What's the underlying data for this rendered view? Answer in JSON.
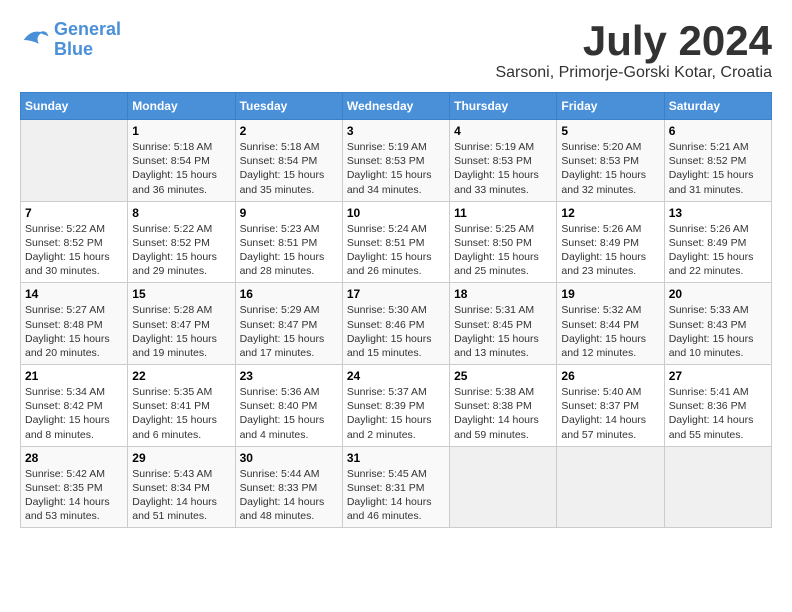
{
  "header": {
    "logo_line1": "General",
    "logo_line2": "Blue",
    "month_year": "July 2024",
    "location": "Sarsoni, Primorje-Gorski Kotar, Croatia"
  },
  "weekdays": [
    "Sunday",
    "Monday",
    "Tuesday",
    "Wednesday",
    "Thursday",
    "Friday",
    "Saturday"
  ],
  "weeks": [
    [
      {
        "day": "",
        "sunrise": "",
        "sunset": "",
        "daylight": ""
      },
      {
        "day": "1",
        "sunrise": "Sunrise: 5:18 AM",
        "sunset": "Sunset: 8:54 PM",
        "daylight": "Daylight: 15 hours and 36 minutes."
      },
      {
        "day": "2",
        "sunrise": "Sunrise: 5:18 AM",
        "sunset": "Sunset: 8:54 PM",
        "daylight": "Daylight: 15 hours and 35 minutes."
      },
      {
        "day": "3",
        "sunrise": "Sunrise: 5:19 AM",
        "sunset": "Sunset: 8:53 PM",
        "daylight": "Daylight: 15 hours and 34 minutes."
      },
      {
        "day": "4",
        "sunrise": "Sunrise: 5:19 AM",
        "sunset": "Sunset: 8:53 PM",
        "daylight": "Daylight: 15 hours and 33 minutes."
      },
      {
        "day": "5",
        "sunrise": "Sunrise: 5:20 AM",
        "sunset": "Sunset: 8:53 PM",
        "daylight": "Daylight: 15 hours and 32 minutes."
      },
      {
        "day": "6",
        "sunrise": "Sunrise: 5:21 AM",
        "sunset": "Sunset: 8:52 PM",
        "daylight": "Daylight: 15 hours and 31 minutes."
      }
    ],
    [
      {
        "day": "7",
        "sunrise": "Sunrise: 5:22 AM",
        "sunset": "Sunset: 8:52 PM",
        "daylight": "Daylight: 15 hours and 30 minutes."
      },
      {
        "day": "8",
        "sunrise": "Sunrise: 5:22 AM",
        "sunset": "Sunset: 8:52 PM",
        "daylight": "Daylight: 15 hours and 29 minutes."
      },
      {
        "day": "9",
        "sunrise": "Sunrise: 5:23 AM",
        "sunset": "Sunset: 8:51 PM",
        "daylight": "Daylight: 15 hours and 28 minutes."
      },
      {
        "day": "10",
        "sunrise": "Sunrise: 5:24 AM",
        "sunset": "Sunset: 8:51 PM",
        "daylight": "Daylight: 15 hours and 26 minutes."
      },
      {
        "day": "11",
        "sunrise": "Sunrise: 5:25 AM",
        "sunset": "Sunset: 8:50 PM",
        "daylight": "Daylight: 15 hours and 25 minutes."
      },
      {
        "day": "12",
        "sunrise": "Sunrise: 5:26 AM",
        "sunset": "Sunset: 8:49 PM",
        "daylight": "Daylight: 15 hours and 23 minutes."
      },
      {
        "day": "13",
        "sunrise": "Sunrise: 5:26 AM",
        "sunset": "Sunset: 8:49 PM",
        "daylight": "Daylight: 15 hours and 22 minutes."
      }
    ],
    [
      {
        "day": "14",
        "sunrise": "Sunrise: 5:27 AM",
        "sunset": "Sunset: 8:48 PM",
        "daylight": "Daylight: 15 hours and 20 minutes."
      },
      {
        "day": "15",
        "sunrise": "Sunrise: 5:28 AM",
        "sunset": "Sunset: 8:47 PM",
        "daylight": "Daylight: 15 hours and 19 minutes."
      },
      {
        "day": "16",
        "sunrise": "Sunrise: 5:29 AM",
        "sunset": "Sunset: 8:47 PM",
        "daylight": "Daylight: 15 hours and 17 minutes."
      },
      {
        "day": "17",
        "sunrise": "Sunrise: 5:30 AM",
        "sunset": "Sunset: 8:46 PM",
        "daylight": "Daylight: 15 hours and 15 minutes."
      },
      {
        "day": "18",
        "sunrise": "Sunrise: 5:31 AM",
        "sunset": "Sunset: 8:45 PM",
        "daylight": "Daylight: 15 hours and 13 minutes."
      },
      {
        "day": "19",
        "sunrise": "Sunrise: 5:32 AM",
        "sunset": "Sunset: 8:44 PM",
        "daylight": "Daylight: 15 hours and 12 minutes."
      },
      {
        "day": "20",
        "sunrise": "Sunrise: 5:33 AM",
        "sunset": "Sunset: 8:43 PM",
        "daylight": "Daylight: 15 hours and 10 minutes."
      }
    ],
    [
      {
        "day": "21",
        "sunrise": "Sunrise: 5:34 AM",
        "sunset": "Sunset: 8:42 PM",
        "daylight": "Daylight: 15 hours and 8 minutes."
      },
      {
        "day": "22",
        "sunrise": "Sunrise: 5:35 AM",
        "sunset": "Sunset: 8:41 PM",
        "daylight": "Daylight: 15 hours and 6 minutes."
      },
      {
        "day": "23",
        "sunrise": "Sunrise: 5:36 AM",
        "sunset": "Sunset: 8:40 PM",
        "daylight": "Daylight: 15 hours and 4 minutes."
      },
      {
        "day": "24",
        "sunrise": "Sunrise: 5:37 AM",
        "sunset": "Sunset: 8:39 PM",
        "daylight": "Daylight: 15 hours and 2 minutes."
      },
      {
        "day": "25",
        "sunrise": "Sunrise: 5:38 AM",
        "sunset": "Sunset: 8:38 PM",
        "daylight": "Daylight: 14 hours and 59 minutes."
      },
      {
        "day": "26",
        "sunrise": "Sunrise: 5:40 AM",
        "sunset": "Sunset: 8:37 PM",
        "daylight": "Daylight: 14 hours and 57 minutes."
      },
      {
        "day": "27",
        "sunrise": "Sunrise: 5:41 AM",
        "sunset": "Sunset: 8:36 PM",
        "daylight": "Daylight: 14 hours and 55 minutes."
      }
    ],
    [
      {
        "day": "28",
        "sunrise": "Sunrise: 5:42 AM",
        "sunset": "Sunset: 8:35 PM",
        "daylight": "Daylight: 14 hours and 53 minutes."
      },
      {
        "day": "29",
        "sunrise": "Sunrise: 5:43 AM",
        "sunset": "Sunset: 8:34 PM",
        "daylight": "Daylight: 14 hours and 51 minutes."
      },
      {
        "day": "30",
        "sunrise": "Sunrise: 5:44 AM",
        "sunset": "Sunset: 8:33 PM",
        "daylight": "Daylight: 14 hours and 48 minutes."
      },
      {
        "day": "31",
        "sunrise": "Sunrise: 5:45 AM",
        "sunset": "Sunset: 8:31 PM",
        "daylight": "Daylight: 14 hours and 46 minutes."
      },
      {
        "day": "",
        "sunrise": "",
        "sunset": "",
        "daylight": ""
      },
      {
        "day": "",
        "sunrise": "",
        "sunset": "",
        "daylight": ""
      },
      {
        "day": "",
        "sunrise": "",
        "sunset": "",
        "daylight": ""
      }
    ]
  ]
}
